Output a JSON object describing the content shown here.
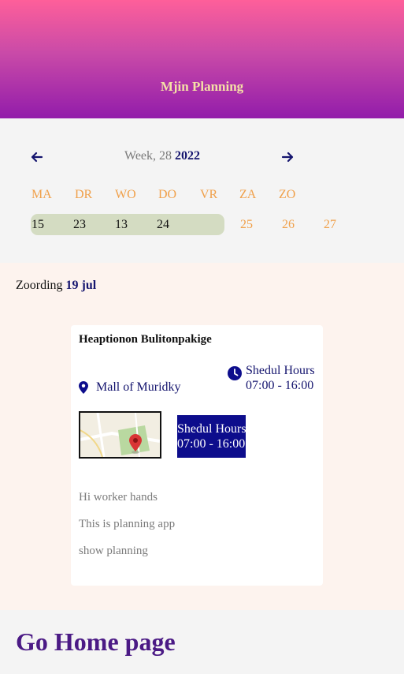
{
  "header": {
    "title": "Mjin Planning"
  },
  "calendar": {
    "week_prefix": "Week, 28",
    "year": "2022",
    "day_names": [
      "MA",
      "DR",
      "WO",
      "DO",
      "VR",
      "ZA",
      "ZO"
    ],
    "dates": [
      {
        "label": "15",
        "active": true
      },
      {
        "label": "23",
        "active": true
      },
      {
        "label": "13",
        "active": true
      },
      {
        "label": "24",
        "active": true
      },
      {
        "label": "25",
        "active": false
      },
      {
        "label": "26",
        "active": false
      },
      {
        "label": "27",
        "active": false
      }
    ],
    "prev_icon": "arrow-left-icon",
    "next_icon": "arrow-right-icon"
  },
  "sort": {
    "label": "Zoording",
    "date": "19 jul"
  },
  "card": {
    "title": "Heaptionon Bulitonpakige",
    "location": "Mall of Muridky",
    "hours_label": "Shedul Hours",
    "hours_time": "07:00 - 16:00",
    "box_label": "Shedul Hours",
    "box_time": "07:00 - 16:00",
    "notes": [
      "Hi worker hands",
      "This is planning app",
      "show planning"
    ]
  },
  "footer": {
    "home_link": "Go Home page"
  },
  "colors": {
    "header_top": "#fe5f9a",
    "header_bottom": "#921caa",
    "header_text": "#f5e0a6",
    "accent_navy": "#14146e",
    "day_orange": "#f0a04a",
    "week_bar": "#d4dcc2",
    "hours_box": "#0d0d8c",
    "link_purple": "#4b1a85"
  }
}
